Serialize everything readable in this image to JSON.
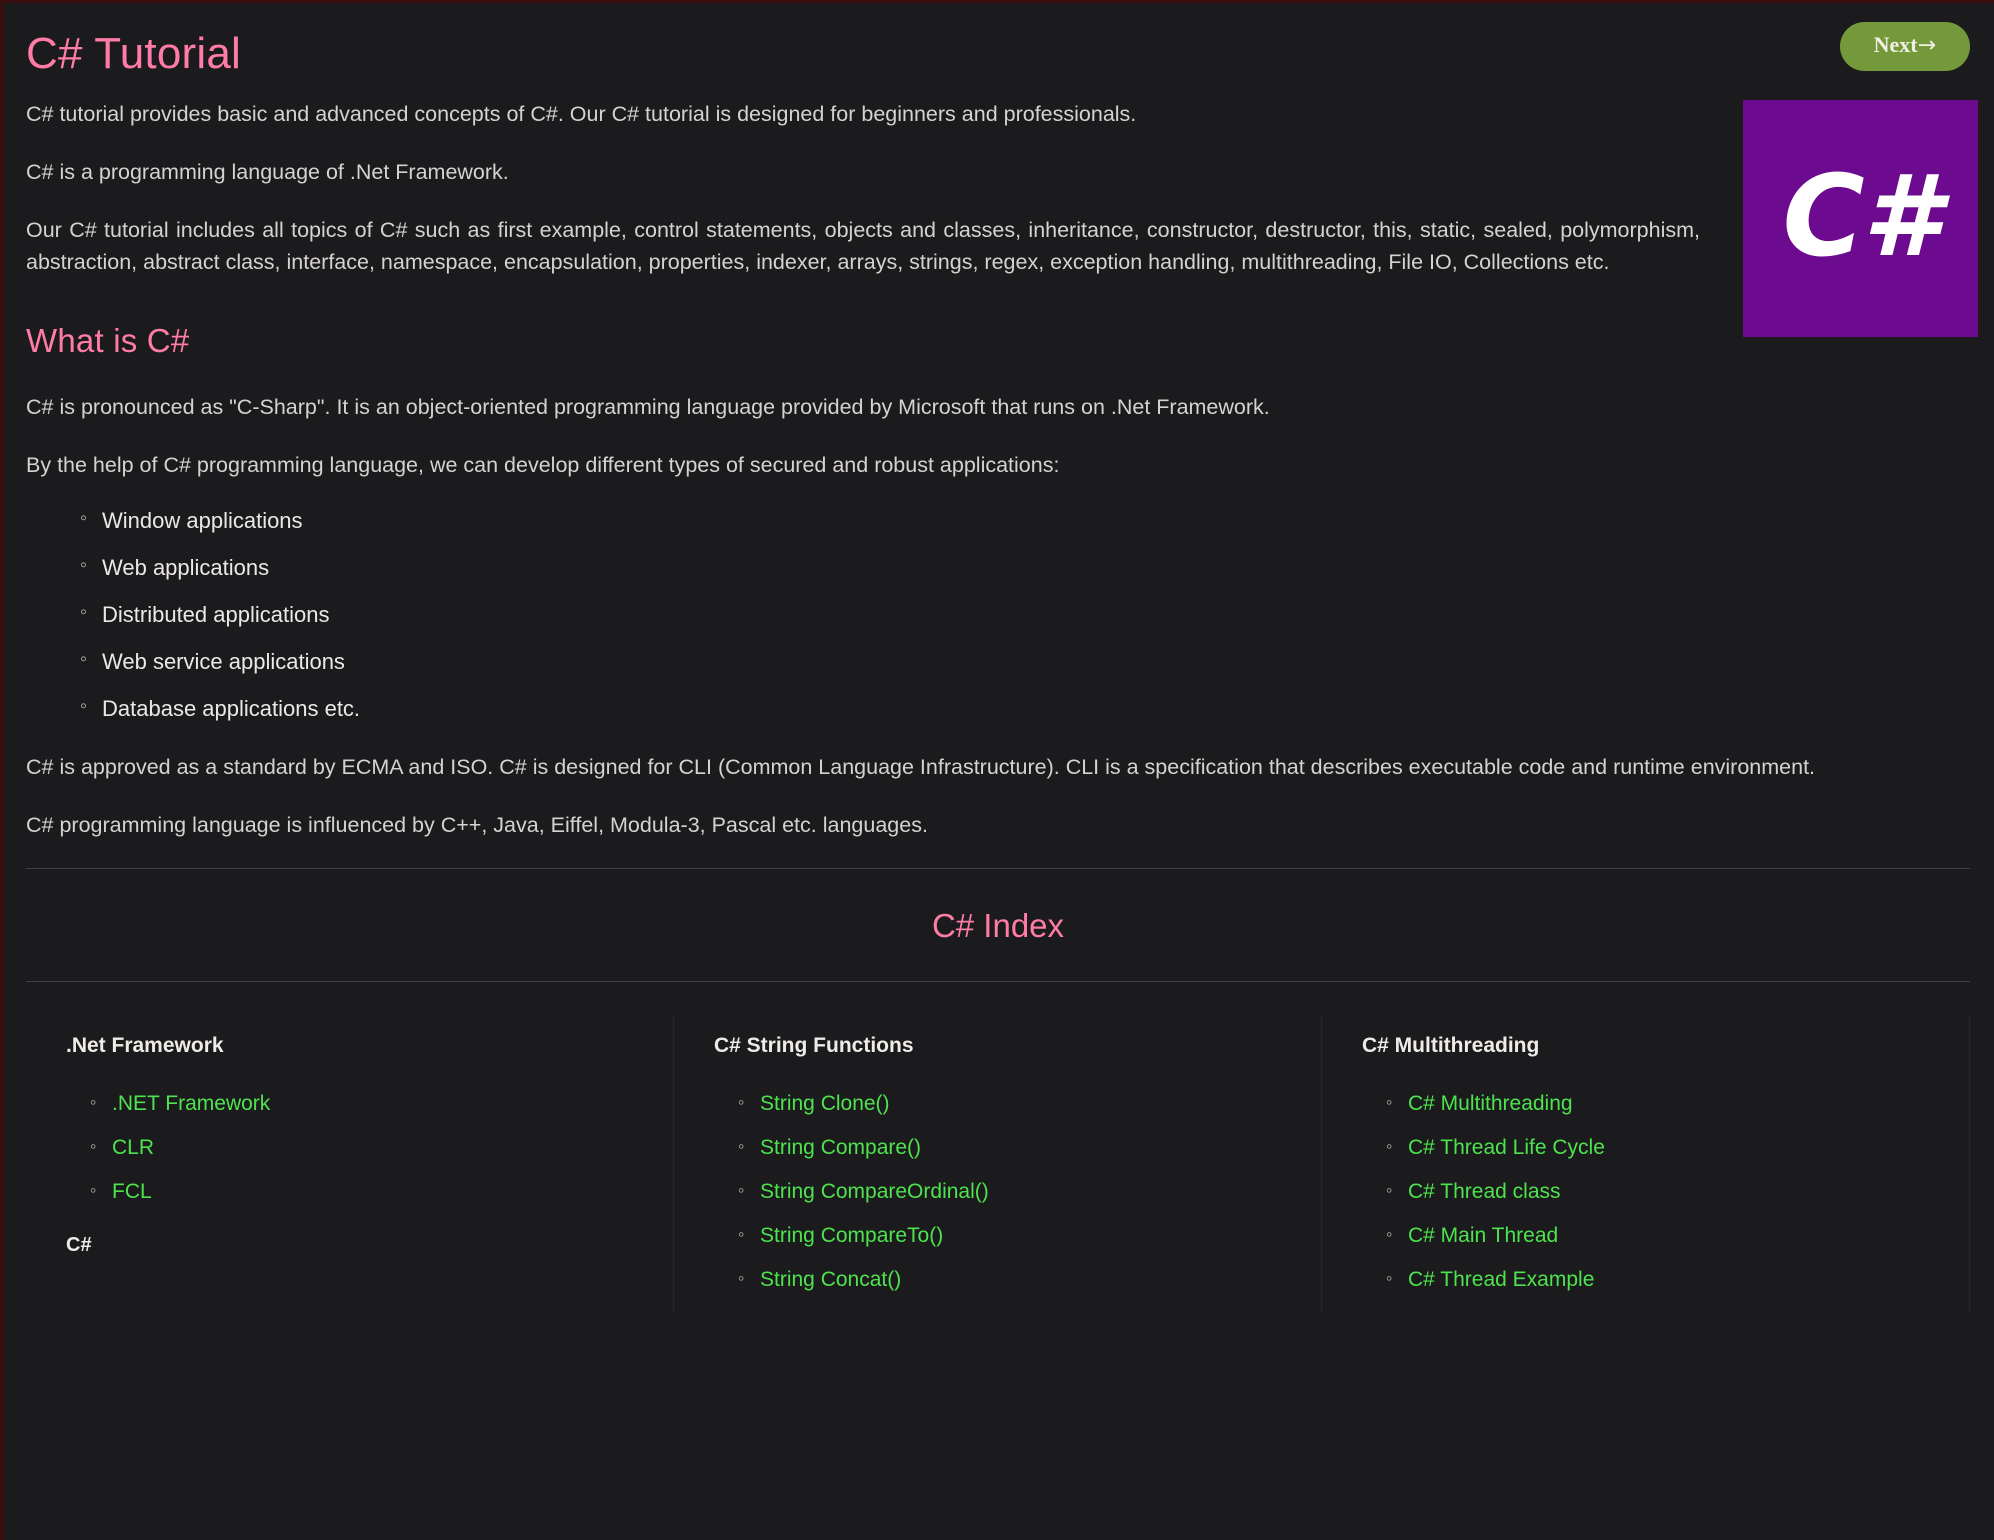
{
  "header": {
    "title": "C# Tutorial",
    "next_label": "Next",
    "next_arrow": "→"
  },
  "logo": {
    "text": "C#",
    "background": "#6c0b90",
    "foreground": "#ffffff"
  },
  "intro": {
    "p1": "C# tutorial provides basic and advanced concepts of C#. Our C# tutorial is designed for beginners and professionals.",
    "p2": "C# is a programming language of .Net Framework.",
    "p3": "Our C# tutorial includes all topics of C# such as first example, control statements, objects and classes, inheritance, constructor, destructor, this, static, sealed, polymorphism, abstraction, abstract class, interface, namespace, encapsulation, properties, indexer, arrays, strings, regex, exception handling, multithreading, File IO, Collections etc."
  },
  "what_is": {
    "heading": "What is C#",
    "p1": "C# is pronounced as \"C-Sharp\". It is an object-oriented programming language provided by Microsoft that runs on .Net Framework.",
    "p2": "By the help of C# programming language, we can develop different types of secured and robust applications:",
    "bullets": [
      "Window applications",
      "Web applications",
      "Distributed applications",
      "Web service applications",
      "Database applications etc."
    ],
    "p3": "C# is approved as a standard by ECMA and ISO. C# is designed for CLI (Common Language Infrastructure). CLI is a specification that describes executable code and runtime environment.",
    "p4": "C# programming language is influenced by C++, Java, Eiffel, Modula-3, Pascal etc. languages."
  },
  "index": {
    "title": "C# Index",
    "columns": [
      {
        "heading": ".Net Framework",
        "links": [
          ".NET Framework",
          "CLR",
          "FCL"
        ],
        "subheading": "C#"
      },
      {
        "heading": "C# String Functions",
        "links": [
          "String Clone()",
          "String Compare()",
          "String CompareOrdinal()",
          "String CompareTo()",
          "String Concat()"
        ],
        "subheading": ""
      },
      {
        "heading": "C# Multithreading",
        "links": [
          "C# Multithreading",
          "C# Thread Life Cycle",
          "C# Thread class",
          "C# Main Thread",
          "C# Thread Example"
        ],
        "subheading": ""
      }
    ]
  },
  "colors": {
    "background": "#1b1b1d",
    "heading_pink": "#ff7ba8",
    "link_green": "#4ee34e",
    "button_green": "#74993a",
    "body_text": "#d6d3ce"
  }
}
